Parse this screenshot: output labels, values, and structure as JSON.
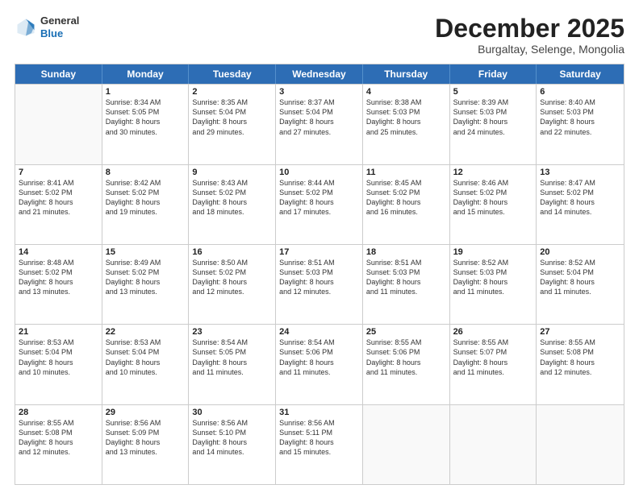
{
  "logo": {
    "general": "General",
    "blue": "Blue"
  },
  "header": {
    "month": "December 2025",
    "location": "Burgaltay, Selenge, Mongolia"
  },
  "weekdays": [
    "Sunday",
    "Monday",
    "Tuesday",
    "Wednesday",
    "Thursday",
    "Friday",
    "Saturday"
  ],
  "weeks": [
    [
      {
        "day": "",
        "info": ""
      },
      {
        "day": "1",
        "info": "Sunrise: 8:34 AM\nSunset: 5:05 PM\nDaylight: 8 hours\nand 30 minutes."
      },
      {
        "day": "2",
        "info": "Sunrise: 8:35 AM\nSunset: 5:04 PM\nDaylight: 8 hours\nand 29 minutes."
      },
      {
        "day": "3",
        "info": "Sunrise: 8:37 AM\nSunset: 5:04 PM\nDaylight: 8 hours\nand 27 minutes."
      },
      {
        "day": "4",
        "info": "Sunrise: 8:38 AM\nSunset: 5:03 PM\nDaylight: 8 hours\nand 25 minutes."
      },
      {
        "day": "5",
        "info": "Sunrise: 8:39 AM\nSunset: 5:03 PM\nDaylight: 8 hours\nand 24 minutes."
      },
      {
        "day": "6",
        "info": "Sunrise: 8:40 AM\nSunset: 5:03 PM\nDaylight: 8 hours\nand 22 minutes."
      }
    ],
    [
      {
        "day": "7",
        "info": "Sunrise: 8:41 AM\nSunset: 5:02 PM\nDaylight: 8 hours\nand 21 minutes."
      },
      {
        "day": "8",
        "info": "Sunrise: 8:42 AM\nSunset: 5:02 PM\nDaylight: 8 hours\nand 19 minutes."
      },
      {
        "day": "9",
        "info": "Sunrise: 8:43 AM\nSunset: 5:02 PM\nDaylight: 8 hours\nand 18 minutes."
      },
      {
        "day": "10",
        "info": "Sunrise: 8:44 AM\nSunset: 5:02 PM\nDaylight: 8 hours\nand 17 minutes."
      },
      {
        "day": "11",
        "info": "Sunrise: 8:45 AM\nSunset: 5:02 PM\nDaylight: 8 hours\nand 16 minutes."
      },
      {
        "day": "12",
        "info": "Sunrise: 8:46 AM\nSunset: 5:02 PM\nDaylight: 8 hours\nand 15 minutes."
      },
      {
        "day": "13",
        "info": "Sunrise: 8:47 AM\nSunset: 5:02 PM\nDaylight: 8 hours\nand 14 minutes."
      }
    ],
    [
      {
        "day": "14",
        "info": "Sunrise: 8:48 AM\nSunset: 5:02 PM\nDaylight: 8 hours\nand 13 minutes."
      },
      {
        "day": "15",
        "info": "Sunrise: 8:49 AM\nSunset: 5:02 PM\nDaylight: 8 hours\nand 13 minutes."
      },
      {
        "day": "16",
        "info": "Sunrise: 8:50 AM\nSunset: 5:02 PM\nDaylight: 8 hours\nand 12 minutes."
      },
      {
        "day": "17",
        "info": "Sunrise: 8:51 AM\nSunset: 5:03 PM\nDaylight: 8 hours\nand 12 minutes."
      },
      {
        "day": "18",
        "info": "Sunrise: 8:51 AM\nSunset: 5:03 PM\nDaylight: 8 hours\nand 11 minutes."
      },
      {
        "day": "19",
        "info": "Sunrise: 8:52 AM\nSunset: 5:03 PM\nDaylight: 8 hours\nand 11 minutes."
      },
      {
        "day": "20",
        "info": "Sunrise: 8:52 AM\nSunset: 5:04 PM\nDaylight: 8 hours\nand 11 minutes."
      }
    ],
    [
      {
        "day": "21",
        "info": "Sunrise: 8:53 AM\nSunset: 5:04 PM\nDaylight: 8 hours\nand 10 minutes."
      },
      {
        "day": "22",
        "info": "Sunrise: 8:53 AM\nSunset: 5:04 PM\nDaylight: 8 hours\nand 10 minutes."
      },
      {
        "day": "23",
        "info": "Sunrise: 8:54 AM\nSunset: 5:05 PM\nDaylight: 8 hours\nand 11 minutes."
      },
      {
        "day": "24",
        "info": "Sunrise: 8:54 AM\nSunset: 5:06 PM\nDaylight: 8 hours\nand 11 minutes."
      },
      {
        "day": "25",
        "info": "Sunrise: 8:55 AM\nSunset: 5:06 PM\nDaylight: 8 hours\nand 11 minutes."
      },
      {
        "day": "26",
        "info": "Sunrise: 8:55 AM\nSunset: 5:07 PM\nDaylight: 8 hours\nand 11 minutes."
      },
      {
        "day": "27",
        "info": "Sunrise: 8:55 AM\nSunset: 5:08 PM\nDaylight: 8 hours\nand 12 minutes."
      }
    ],
    [
      {
        "day": "28",
        "info": "Sunrise: 8:55 AM\nSunset: 5:08 PM\nDaylight: 8 hours\nand 12 minutes."
      },
      {
        "day": "29",
        "info": "Sunrise: 8:56 AM\nSunset: 5:09 PM\nDaylight: 8 hours\nand 13 minutes."
      },
      {
        "day": "30",
        "info": "Sunrise: 8:56 AM\nSunset: 5:10 PM\nDaylight: 8 hours\nand 14 minutes."
      },
      {
        "day": "31",
        "info": "Sunrise: 8:56 AM\nSunset: 5:11 PM\nDaylight: 8 hours\nand 15 minutes."
      },
      {
        "day": "",
        "info": ""
      },
      {
        "day": "",
        "info": ""
      },
      {
        "day": "",
        "info": ""
      }
    ]
  ]
}
